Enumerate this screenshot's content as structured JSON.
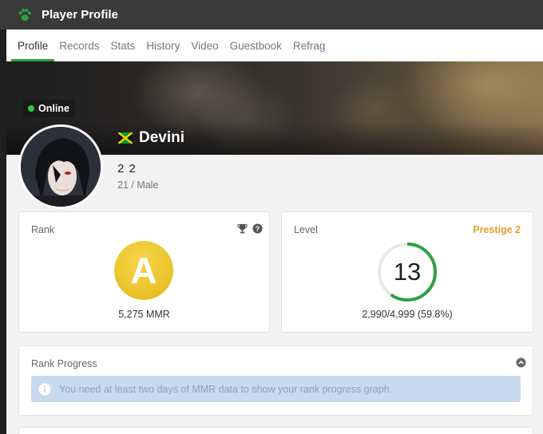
{
  "app": {
    "title": "Player Profile",
    "icon": "paw-icon",
    "accent": "#2ea043"
  },
  "tabs": [
    {
      "label": "Profile",
      "active": true
    },
    {
      "label": "Records"
    },
    {
      "label": "Stats"
    },
    {
      "label": "History"
    },
    {
      "label": "Video"
    },
    {
      "label": "Guestbook"
    },
    {
      "label": "Refrag"
    }
  ],
  "profile": {
    "status": "Online",
    "status_color": "#2ecc40",
    "name": "Devini",
    "flag": "jamaica-flag-icon",
    "handle": "2 2",
    "age_sex": "21 / Male"
  },
  "rank": {
    "title": "Rank",
    "badge_letter": "A",
    "badge_color": "#eac52c",
    "mmr_text": "5,275 MMR",
    "icons": [
      "trophy-icon",
      "help-icon"
    ]
  },
  "level": {
    "title": "Level",
    "prestige": "Prestige 2",
    "prestige_color": "#e2a227",
    "level": "13",
    "progress_fraction": 0.598,
    "xp_text": "2,990/4,999 (59.8%)"
  },
  "rank_progress": {
    "title": "Rank Progress",
    "message": "You need at least two days of MMR data to show your rank progress graph.",
    "icons": [
      "collapse-icon",
      "info-icon"
    ]
  }
}
